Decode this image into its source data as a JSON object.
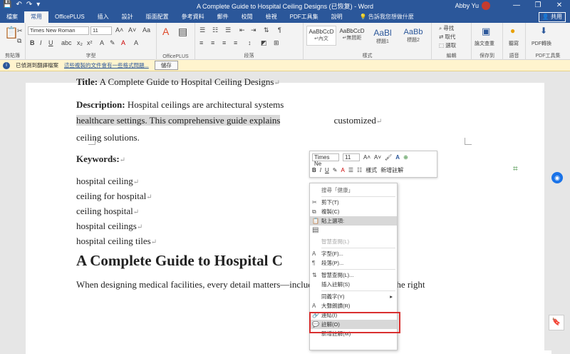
{
  "window": {
    "title": "A Complete Guide to Hospital Ceiling Designs (已恢复) - Word",
    "user": "Abby Yu",
    "controls": [
      "—",
      "❐",
      "✕"
    ]
  },
  "qat": [
    "💾",
    "↶",
    "↷",
    "▾"
  ],
  "tabs": [
    "檔案",
    "常用",
    "OfficePLUS",
    "插入",
    "設計",
    "版面配置",
    "參考資料",
    "郵件",
    "校閱",
    "檢視",
    "PDF工具集",
    "說明"
  ],
  "tell_me": "告訴我您想做什麼",
  "share": "共用",
  "ribbon": {
    "font_name": "Times New Roman",
    "font_size": "11",
    "groups": [
      "剪貼簿",
      "字型",
      "OfficePLUS",
      "段落",
      "樣式",
      "編輯",
      "保存到",
      "語音",
      "PDF工具集"
    ],
    "styles": [
      {
        "preview": "AaBbCcD",
        "name": "↵內文"
      },
      {
        "preview": "AaBbCcD",
        "name": "↵無間距"
      },
      {
        "preview": "AaBl",
        "name": "標題1"
      },
      {
        "preview": "AaBb",
        "name": "標題2"
      }
    ],
    "edit_items": [
      "尋找",
      "取代",
      "選取"
    ],
    "right_items": [
      "論文查重",
      "聽寫",
      "PDF轉換"
    ]
  },
  "infobar": {
    "icon": "i",
    "label": "已偵測到翻譯檔案",
    "link": "這些複製的文件會有一些格式問題...",
    "button": "儲存"
  },
  "document": {
    "title_label": "Title:",
    "title_text": "A Complete Guide to Hospital Ceiling Designs",
    "desc_label": "Description:",
    "desc_text_1": "Hospital ceilings are architectural systems",
    "desc_text_2": "healthcare settings. This comprehensive guide explains",
    "desc_text_3": "customized",
    "desc_text_4": "ceiling solutions.",
    "keywords_label": "Keywords:",
    "keywords": [
      "hospital ceiling",
      "ceiling for hospital",
      "ceiling hospital",
      "hospital ceilings",
      "hospital ceiling tiles"
    ],
    "heading": "A Complete Guide to Hospital C",
    "heading_tail": "s",
    "body": "When designing medical facilities, every detail matters—including what's overhead. The right",
    "para_mark": "↵"
  },
  "mini_toolbar": {
    "font": "Times Ne",
    "size": "11",
    "styles_label": "樣式",
    "new_comment": "新增註解"
  },
  "context_menu": {
    "search": "搜尋「健康」",
    "items": [
      {
        "icon": "✂",
        "label": "剪下(T)",
        "disabled": false,
        "submenu": false
      },
      {
        "icon": "⧉",
        "label": "複製(C)",
        "disabled": false,
        "submenu": false
      },
      {
        "icon": "📋",
        "label": "貼上選項:",
        "disabled": false,
        "submenu": false,
        "hover": true
      },
      {
        "icon": "",
        "label": "",
        "disabled": true,
        "submenu": false
      },
      {
        "icon": "",
        "label": "智慧查閱(L)",
        "disabled": true,
        "submenu": false
      },
      {
        "icon": "A",
        "label": "字型(F)...",
        "disabled": false,
        "submenu": false
      },
      {
        "icon": "¶",
        "label": "段落(P)...",
        "disabled": false,
        "submenu": false
      },
      {
        "icon": "⇅",
        "label": "智慧查閱(L)...",
        "disabled": false,
        "submenu": false
      },
      {
        "icon": "",
        "label": "插入註解(S)",
        "disabled": false,
        "submenu": false
      },
      {
        "icon": "",
        "label": "同義字(Y)",
        "disabled": false,
        "submenu": true
      },
      {
        "icon": "A",
        "label": "大聲朗讀(R)",
        "disabled": false,
        "submenu": false
      },
      {
        "icon": "🔗",
        "label": "連結(I)",
        "disabled": false,
        "submenu": false
      },
      {
        "icon": "💬",
        "label": "註解(O)",
        "disabled": false,
        "submenu": false,
        "hover": true
      },
      {
        "icon": "",
        "label": "新增註解(M)",
        "disabled": false,
        "submenu": false
      }
    ]
  },
  "colors": {
    "brand": "#2b579a",
    "highlight": "#d93030",
    "selection": "#d9d9d9"
  }
}
